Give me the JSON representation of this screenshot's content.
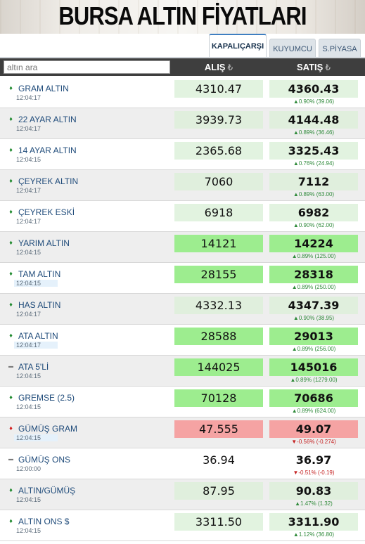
{
  "header": {
    "title": "BURSA ALTIN FİYATLARI"
  },
  "tabs": [
    {
      "label": "KAPALIÇARŞI",
      "active": true
    },
    {
      "label": "KUYUMCU",
      "active": false
    },
    {
      "label": "S.PİYASA",
      "active": false
    }
  ],
  "search": {
    "placeholder": "altın ara"
  },
  "columns": {
    "buy": "ALIŞ",
    "sell": "SATIŞ",
    "currency_symbol": "₺"
  },
  "colors": {
    "up": "#1f8a2e",
    "down": "#d21a1a",
    "green_highlight": "#9ded8f",
    "red_highlight": "#f5a3a3",
    "light_green": "#e2f3e0"
  },
  "rows": [
    {
      "name": "GRAM ALTIN",
      "time": "12:04:17",
      "buy": "4310.47",
      "sell": "4360.43",
      "change": "▲0.90% (39.06)",
      "trend": "up",
      "style": "light",
      "time_highlight": false
    },
    {
      "name": "22 AYAR ALTIN",
      "time": "12:04:17",
      "buy": "3939.73",
      "sell": "4144.48",
      "change": "▲0.89% (36.46)",
      "trend": "up",
      "style": "light",
      "time_highlight": false
    },
    {
      "name": "14 AYAR ALTIN",
      "time": "12:04:15",
      "buy": "2365.68",
      "sell": "3325.43",
      "change": "▲0.76% (24.94)",
      "trend": "up",
      "style": "light",
      "time_highlight": false
    },
    {
      "name": "ÇEYREK ALTIN",
      "time": "12:04:17",
      "buy": "7060",
      "sell": "7112",
      "change": "▲0.89% (63.00)",
      "trend": "up",
      "style": "light",
      "time_highlight": false
    },
    {
      "name": "ÇEYREK ESKİ",
      "time": "12:04:17",
      "buy": "6918",
      "sell": "6982",
      "change": "▲0.90% (62.00)",
      "trend": "up",
      "style": "light",
      "time_highlight": false
    },
    {
      "name": "YARIM ALTIN",
      "time": "12:04:15",
      "buy": "14121",
      "sell": "14224",
      "change": "▲0.89% (125.00)",
      "trend": "up",
      "style": "green",
      "time_highlight": false
    },
    {
      "name": "TAM ALTIN",
      "time": "12:04:15",
      "buy": "28155",
      "sell": "28318",
      "change": "▲0.89% (250.00)",
      "trend": "up",
      "style": "green",
      "time_highlight": true
    },
    {
      "name": "HAS ALTIN",
      "time": "12:04:17",
      "buy": "4332.13",
      "sell": "4347.39",
      "change": "▲0.90% (38.95)",
      "trend": "up",
      "style": "light",
      "time_highlight": false
    },
    {
      "name": "ATA ALTIN",
      "time": "12:04:17",
      "buy": "28588",
      "sell": "29013",
      "change": "▲0.89% (256.00)",
      "trend": "up",
      "style": "green",
      "time_highlight": true
    },
    {
      "name": "ATA 5'Lİ",
      "time": "12:04:15",
      "buy": "144025",
      "sell": "145016",
      "change": "▲0.89% (1279.00)",
      "trend": "flat",
      "style": "green",
      "time_highlight": false
    },
    {
      "name": "GREMSE (2.5)",
      "time": "12:04:15",
      "buy": "70128",
      "sell": "70686",
      "change": "▲0.89% (624.00)",
      "trend": "up",
      "style": "green",
      "time_highlight": false
    },
    {
      "name": "GÜMÜŞ GRAM",
      "time": "12:04:15",
      "buy": "47.555",
      "sell": "49.07",
      "change": "▼-0.56% (-0.274)",
      "trend": "down",
      "style": "red",
      "time_highlight": true
    },
    {
      "name": "GÜMÜŞ ONS",
      "time": "12:00:00",
      "buy": "36.94",
      "sell": "36.97",
      "change": "▼-0.51% (-0.19)",
      "trend": "flat",
      "style": "none",
      "time_highlight": false
    },
    {
      "name": "ALTIN/GÜMÜŞ",
      "time": "12:04:15",
      "buy": "87.95",
      "sell": "90.83",
      "change": "▲1.47% (1.32)",
      "trend": "up",
      "style": "light",
      "time_highlight": false
    },
    {
      "name": "ALTIN ONS $",
      "time": "12:04:15",
      "buy": "3311.50",
      "sell": "3311.90",
      "change": "▲1.12% (36.80)",
      "trend": "up",
      "style": "light",
      "time_highlight": false
    }
  ]
}
